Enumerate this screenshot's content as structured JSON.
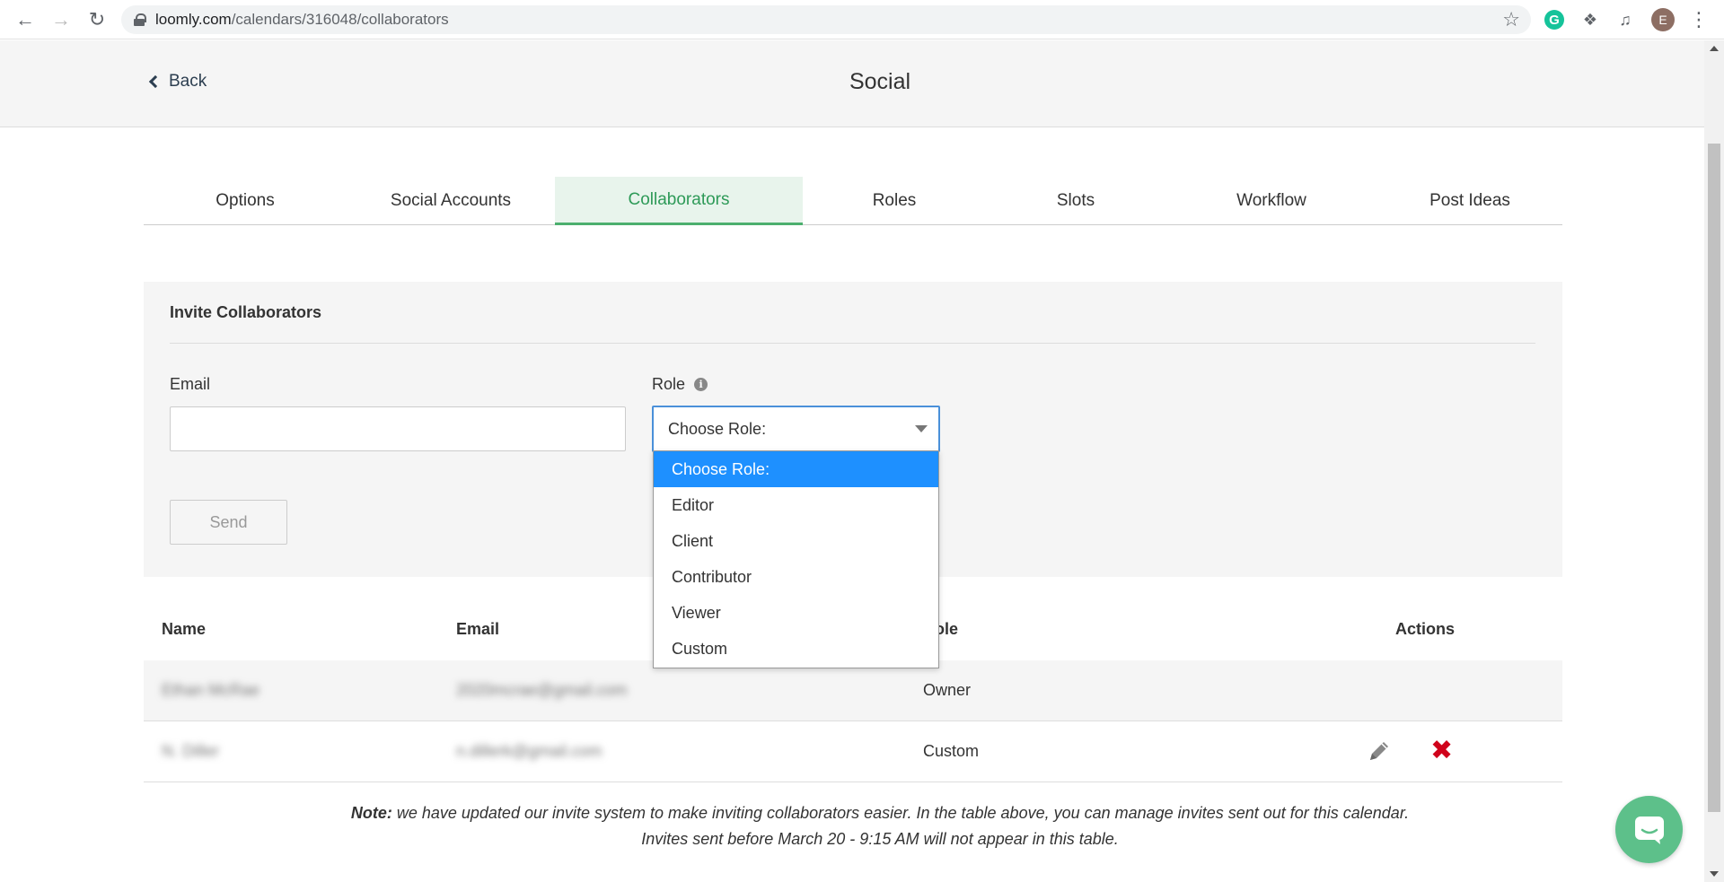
{
  "browser": {
    "url_host": "loomly.com",
    "url_path": "/calendars/316048/collaborators",
    "profile_initial": "E",
    "grammarly_letter": "G"
  },
  "header": {
    "back_label": "Back",
    "title": "Social"
  },
  "tabs": [
    {
      "label": "Options",
      "active": false
    },
    {
      "label": "Social Accounts",
      "active": false
    },
    {
      "label": "Collaborators",
      "active": true
    },
    {
      "label": "Roles",
      "active": false
    },
    {
      "label": "Slots",
      "active": false
    },
    {
      "label": "Workflow",
      "active": false
    },
    {
      "label": "Post Ideas",
      "active": false
    }
  ],
  "invite": {
    "title": "Invite Collaborators",
    "email_label": "Email",
    "email_value": "",
    "role_label": "Role",
    "role_selected": "Choose Role:",
    "send_label": "Send"
  },
  "role_options": [
    "Choose Role:",
    "Editor",
    "Client",
    "Contributor",
    "Viewer",
    "Custom"
  ],
  "table": {
    "headers": {
      "name": "Name",
      "email": "Email",
      "role": "Role",
      "actions": "Actions"
    },
    "rows": [
      {
        "name": "Ethan McRae",
        "email": "2020mcrae@gmail.com",
        "role": "Owner",
        "editable": false
      },
      {
        "name": "N. Diller",
        "email": "n.dillerk@gmail.com",
        "role": "Custom",
        "editable": true
      }
    ]
  },
  "note": {
    "bold": "Note:",
    "text": " we have updated our invite system to make inviting collaborators easier. In the table above, you can manage invites sent out for this calendar. Invites sent before March 20 - 9:15 AM will not appear in this table."
  },
  "colors": {
    "active_tab": "#2e9a58",
    "selected_option": "#1e90ff",
    "delete": "#d0021b",
    "chat": "#5dc08a"
  }
}
